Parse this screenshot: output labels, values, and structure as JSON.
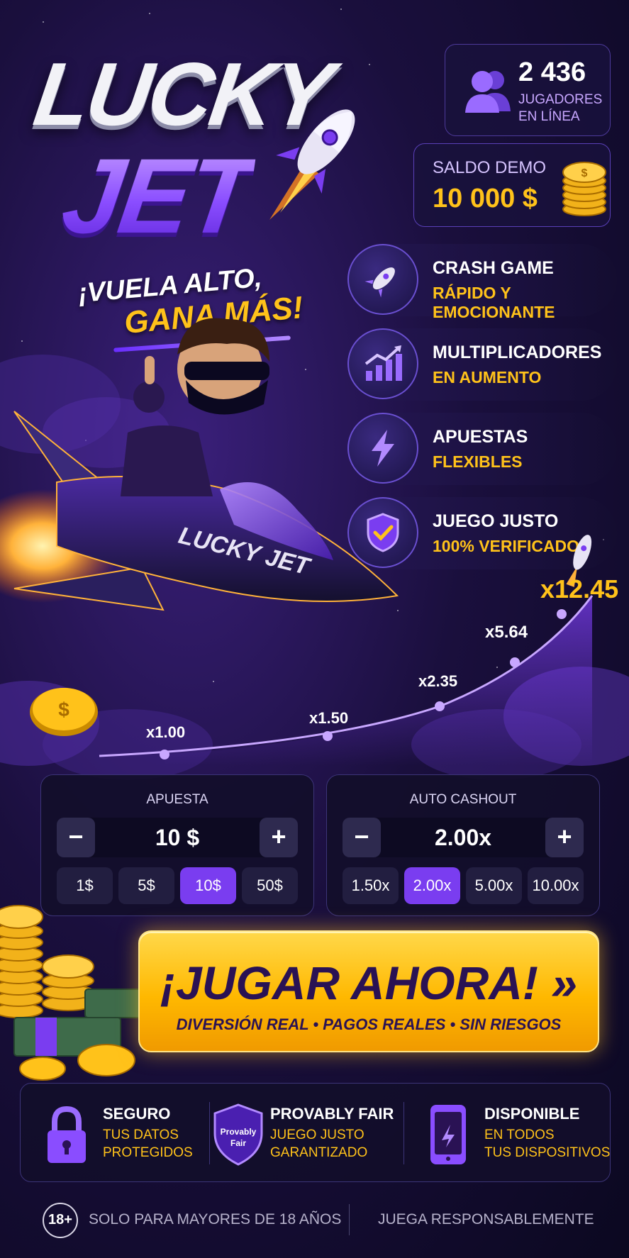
{
  "logo": {
    "line1": "LUCKY",
    "line2": "JET",
    "tagline1": "¡VUELA ALTO,",
    "tagline2": "GANA MÁS!"
  },
  "players": {
    "count": "2 436",
    "label": "JUGADORES EN LÍNEA",
    "icon": "users-icon"
  },
  "demo": {
    "label": "SALDO DEMO",
    "value": "10 000 $",
    "icon": "coins-icon"
  },
  "features": [
    {
      "title": "CRASH GAME",
      "subtitle": "RÁPIDO Y EMOCIONANTE",
      "icon": "rocket-icon"
    },
    {
      "title": "MULTIPLICADORES",
      "subtitle": "EN AUMENTO",
      "icon": "chart-up-icon"
    },
    {
      "title": "APUESTAS",
      "subtitle": "FLEXIBLES",
      "icon": "lightning-icon"
    },
    {
      "title": "JUEGO JUSTO",
      "subtitle": "100% VERIFICADO",
      "icon": "shield-check-icon"
    }
  ],
  "hero": {
    "jet_label": "LUCKY JET"
  },
  "multipliers": [
    "x1.00",
    "x1.50",
    "x2.35",
    "x5.64",
    "x12.45"
  ],
  "bet_panel": {
    "title": "APUESTA",
    "value": "10 $",
    "minus": "−",
    "plus": "+",
    "chips": [
      "1$",
      "5$",
      "10$",
      "50$"
    ],
    "active_chip": 2
  },
  "cashout_panel": {
    "title": "AUTO CASHOUT",
    "value": "2.00x",
    "minus": "−",
    "plus": "+",
    "chips": [
      "1.50x",
      "2.00x",
      "5.00x",
      "10.00x"
    ],
    "active_chip": 1
  },
  "play": {
    "label": "¡JUGAR AHORA! »",
    "subtitle": "DIVERSIÓN REAL • PAGOS REALES • SIN RIESGOS"
  },
  "trust": [
    {
      "title": "SEGURO",
      "line1": "TUS DATOS",
      "line2": "PROTEGIDOS",
      "icon": "lock-icon"
    },
    {
      "title": "PROVABLY FAIR",
      "line1": "JUEGO JUSTO",
      "line2": "GARANTIZADO",
      "icon": "shield-provably-fair-icon",
      "badge_line1": "Provably",
      "badge_line2": "Fair"
    },
    {
      "title": "DISPONIBLE",
      "line1": "EN TODOS",
      "line2": "TUS DISPOSITIVOS",
      "icon": "phone-icon"
    }
  ],
  "footer": {
    "age": "18+",
    "age_text": "SOLO PARA MAYORES DE 18 AÑOS",
    "responsible": "JUEGA RESPONSABLEMENTE"
  },
  "colors": {
    "accent_purple": "#7a3df0",
    "accent_yellow": "#ffc21a",
    "background": "#1a0f3d"
  }
}
